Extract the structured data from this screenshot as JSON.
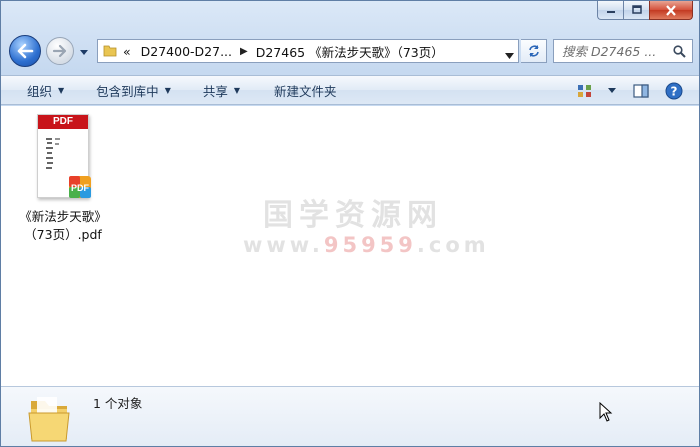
{
  "window": {
    "caption_buttons": [
      "minimize",
      "maximize",
      "close"
    ]
  },
  "address_bar": {
    "overflow_chevron": "«",
    "crumbs": [
      "D27400-D27...",
      "D27465 《新法步天歌》（73页）"
    ]
  },
  "search": {
    "placeholder": "搜索 D27465 ..."
  },
  "toolbar": {
    "organize": "组织",
    "include_in_library": "包含到库中",
    "share": "共享",
    "new_folder": "新建文件夹"
  },
  "files": [
    {
      "type": "pdf",
      "thumb_label": "PDF",
      "name_line1": "《新法步天歌》",
      "name_line2": "（73页）.pdf"
    }
  ],
  "watermark": {
    "line1": "国学资源网",
    "line2_prefix": "www.",
    "line2_mid": "95959",
    "line2_suffix": ".com"
  },
  "details": {
    "count_text": "1 个对象"
  },
  "colors": {
    "accent": "#2d6fd0",
    "toolbar_text": "#1e395b",
    "pdf_red": "#c8141a"
  }
}
